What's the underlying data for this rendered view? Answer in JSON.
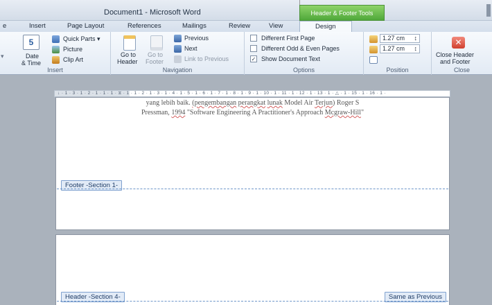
{
  "window": {
    "title": "Document1 - Microsoft Word",
    "contextual_tab_title": "Header & Footer Tools"
  },
  "tabs": [
    {
      "label": "e"
    },
    {
      "label": "Insert"
    },
    {
      "label": "Page Layout"
    },
    {
      "label": "References"
    },
    {
      "label": "Mailings"
    },
    {
      "label": "Review"
    },
    {
      "label": "View"
    },
    {
      "label": "Design",
      "active": true
    }
  ],
  "ribbon": {
    "insert": {
      "label": "Insert",
      "date_time_line1": "Date",
      "date_time_line2": "& Time",
      "quick_parts": "Quick Parts ▾",
      "picture": "Picture",
      "clip_art": "Clip Art"
    },
    "navigation": {
      "label": "Navigation",
      "goto_header_line1": "Go to",
      "goto_header_line2": "Header",
      "goto_footer_line1": "Go to",
      "goto_footer_line2": "Footer",
      "previous": "Previous",
      "next": "Next",
      "link_to_previous": "Link to Previous"
    },
    "options": {
      "label": "Options",
      "different_first_page": "Different First Page",
      "different_first_page_checked": false,
      "different_odd_even": "Different Odd & Even Pages",
      "different_odd_even_checked": false,
      "show_document_text": "Show Document Text",
      "show_document_text_checked": true,
      "check_mark": "✓"
    },
    "position": {
      "label": "Position",
      "header_from_top": "1.27 cm",
      "footer_from_bottom": "1.27 cm",
      "spin_arrows": "↕"
    },
    "close": {
      "label": "Close",
      "button_line1": "Close Header",
      "button_line2": "and Footer",
      "x_glyph": "✕"
    }
  },
  "ruler": {
    "text": "↓ · 1 · 3 · 1 · 2 · 1 · 1 · 1 · ⧖ · 1 · 1 · 2 · 1 · 3 · 1 · 4 · 1 · 5 · 1 · 6 · 1 · 7 · 1 · 8 · 1 · 9 · 1 · 10 · 1 · 11 · 1 · 12 · 1 · 13 · 1 · △ · 1 · 15 · 1 · 16 · 1 ·"
  },
  "document": {
    "line1_a": "yang lebih baik. ",
    "line1_b": "(pengembangan",
    "line1_c": " ",
    "line1_d": "perangkat",
    "line1_e": " ",
    "line1_f": "lunak",
    "line1_g": " Model Air ",
    "line1_h": "Terjun",
    "line1_i": ") Roger S",
    "line2_a": "Pressman, ",
    "line2_b": "1994",
    "line2_c": " \"Software Engineering A Practitioner's Approach ",
    "line2_d": "Mcgraw-Hill",
    "line2_e": "\"",
    "footer_label": "Footer -Section 1-",
    "header_label": "Header -Section 4-",
    "same_as_previous": "Same as Previous"
  }
}
